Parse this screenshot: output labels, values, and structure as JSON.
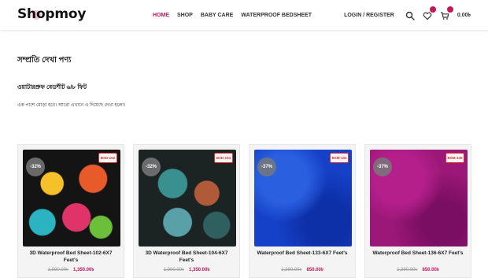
{
  "header": {
    "logo": "Shopmoy",
    "nav": [
      {
        "label": "HOME",
        "active": true
      },
      {
        "label": "SHOP",
        "active": false
      },
      {
        "label": "BABY CARE",
        "active": false
      },
      {
        "label": "WATERPROOF BEDSHEET",
        "active": false
      }
    ],
    "login_label": "LOGIN / REGISTER",
    "cart_total": "0.00৳",
    "accent_color": "#c2185b"
  },
  "section": {
    "title": "সম্প্রতি দেখা পণ্য",
    "post_title": "ওয়াটারপ্রুফ বেডশীট ৬/৮ ফিট",
    "excerpt": "এক পাশে মোড়া হবে। আরো এখানে এ দিয়েছে দেখা হলো।"
  },
  "products": [
    {
      "discount": "-32%",
      "sku": "BSD-102",
      "title": "3D Waterproof Bed Sheet-102-6X7 Feet's",
      "old_price": "1,990.00৳",
      "new_price": "1,350.00৳",
      "theme": "black-floral"
    },
    {
      "discount": "-32%",
      "sku": "B3D-104",
      "title": "3D Waterproof Bed Sheet-104-6X7 Feet's",
      "old_price": "1,990.00৳",
      "new_price": "1,350.00৳",
      "theme": "dark-teal-floral"
    },
    {
      "discount": "-37%",
      "sku": "BSM-133",
      "title": "Waterproof Bed Sheet-133-6X7 Feet's",
      "old_price": "1,390.00৳",
      "new_price": "850.00৳",
      "theme": "blue"
    },
    {
      "discount": "-37%",
      "sku": "BSM-136",
      "title": "Waterproof Bed Sheet-136-6X7 Feet's",
      "old_price": "1,390.00৳",
      "new_price": "850.00৳",
      "theme": "magenta"
    }
  ]
}
